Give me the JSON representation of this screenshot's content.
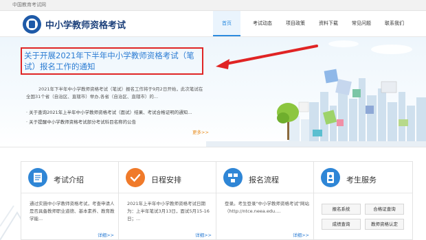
{
  "top_bar": {
    "text": "中国教育考试网"
  },
  "header": {
    "site_title": "中小学教师资格考试"
  },
  "nav": [
    "首页",
    "考试动态",
    "项目政策",
    "资料下载",
    "常见问题",
    "联系我们"
  ],
  "hero": {
    "headline": "关于开展2021年下半年中小学教师资格考试（笔试）报名工作的通知",
    "summary": "2021年下半年中小学教师资格考试（笔试）报名工作将于9月2日开始，此次笔试在全国31个省（自治区、直辖市）举办,各省（自治区、直辖市）的...",
    "news": [
      "· 关于查询2021年上半年中小学教师资格考试（面试）结果、考试合格证明的通知...",
      "· 关于提醒中小学教师资格考试部分考试科目名称的公告"
    ],
    "more": "更多>>"
  },
  "cards": [
    {
      "title": "考试介绍",
      "body": "通过实施中小学教师资格考试，考查申请人是否具备教师职业道德、基本素养、教育教学能...",
      "more": "详细>>"
    },
    {
      "title": "日程安排",
      "body": "2021年上半年中小学教师资格考试日期为：上半年笔试3月13日，面试5月15-16日；...",
      "more": "详细>>"
    },
    {
      "title": "报名流程",
      "body": "登录。考生登录\"中小学教师资格考试\"网站（http://ntce.neea.edu....",
      "more": "详细>>"
    },
    {
      "title": "考生服务",
      "buttons": [
        "报名系统",
        "合格证查询",
        "成绩查询",
        "教师资格认定"
      ]
    }
  ],
  "colors": {
    "brand_blue": "#1b3f7a",
    "link_blue": "#2b7cd3",
    "highlight_red": "#e02424",
    "accent_orange": "#e88a1a"
  }
}
